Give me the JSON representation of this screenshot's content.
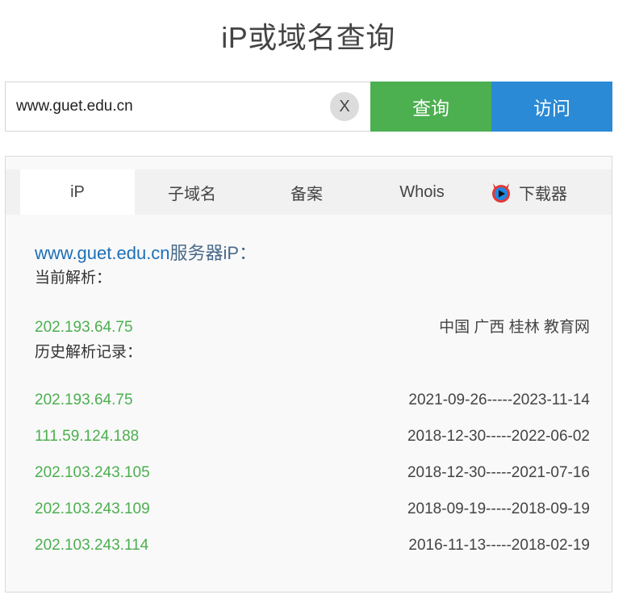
{
  "page": {
    "title": "iP或域名查询"
  },
  "search": {
    "value": "www.guet.edu.cn",
    "clear_label": "X",
    "query_label": "查询",
    "visit_label": "访问"
  },
  "tabs": [
    {
      "label": "iP",
      "active": true
    },
    {
      "label": "子域名"
    },
    {
      "label": "备案"
    },
    {
      "label": "Whois"
    },
    {
      "label": "下载器",
      "icon": "devil-icon"
    }
  ],
  "result": {
    "domain": "www.guet.edu.cn",
    "server_label": "服务器iP：",
    "current_label": "当前解析：",
    "current": {
      "ip": "202.193.64.75",
      "location": "中国 广西 桂林 教育网"
    },
    "history_label": "历史解析记录：",
    "history": [
      {
        "ip": "202.193.64.75",
        "range": "2021-09-26-----2023-11-14"
      },
      {
        "ip": "111.59.124.188",
        "range": "2018-12-30-----2022-06-02"
      },
      {
        "ip": "202.103.243.105",
        "range": "2018-12-30-----2021-07-16"
      },
      {
        "ip": "202.103.243.109",
        "range": "2018-09-19-----2018-09-19"
      },
      {
        "ip": "202.103.243.114",
        "range": "2016-11-13-----2018-02-19"
      }
    ]
  },
  "colors": {
    "green": "#4caf50",
    "blue": "#2a8ad6",
    "link": "#1c6fb8"
  }
}
